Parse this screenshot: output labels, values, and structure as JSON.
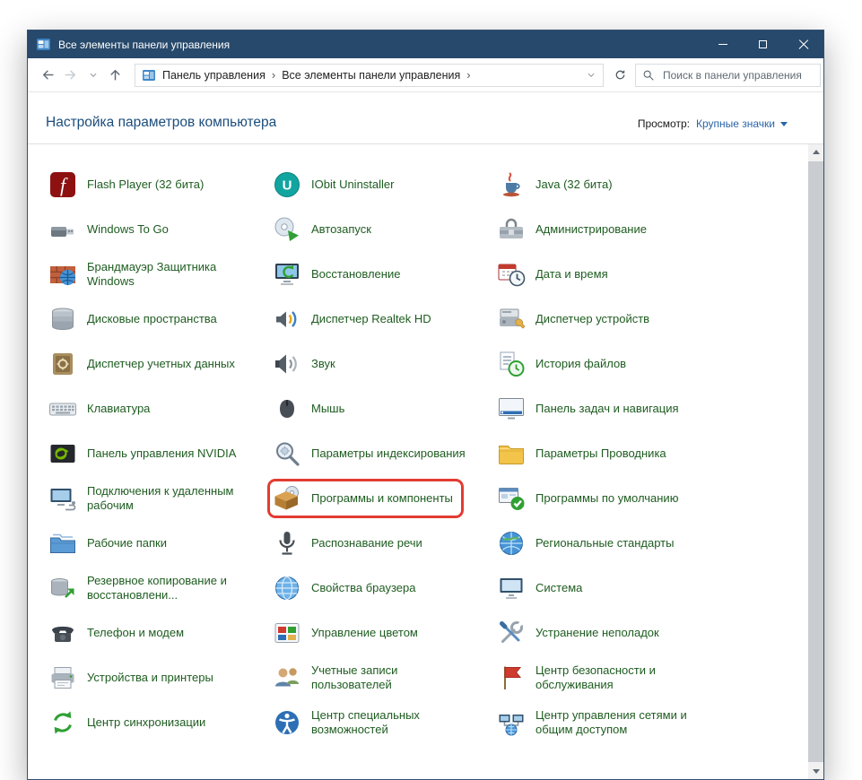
{
  "window": {
    "title": "Все элементы панели управления"
  },
  "toolbar": {
    "back_icon": "arrow-left",
    "forward_icon": "arrow-right",
    "recent_icon": "chevron-down",
    "up_icon": "arrow-up",
    "refresh_icon": "refresh",
    "breadcrumb": {
      "root_icon": "control-panel",
      "separator": "›",
      "items": [
        "Панель управления",
        "Все элементы панели управления"
      ]
    },
    "search": {
      "icon": "search",
      "placeholder": "Поиск в панели управления"
    }
  },
  "header": {
    "title": "Настройка параметров компьютера",
    "view_label": "Просмотр:",
    "view_value": "Крупные значки"
  },
  "annotation": {
    "shape": "rounded-rectangle",
    "color": "#e23c32",
    "target": "Программы и компоненты"
  },
  "items": [
    {
      "label": "Flash Player (32 бита)",
      "icon": "flash-player"
    },
    {
      "label": "IObit Uninstaller",
      "icon": "iobit-uninstaller"
    },
    {
      "label": "Java (32 бита)",
      "icon": "java"
    },
    {
      "label": "Windows To Go",
      "icon": "windows-to-go"
    },
    {
      "label": "Автозапуск",
      "icon": "autoplay"
    },
    {
      "label": "Администрирование",
      "icon": "admin-tools"
    },
    {
      "label": "Брандмауэр Защитника Windows",
      "icon": "firewall"
    },
    {
      "label": "Восстановление",
      "icon": "recovery"
    },
    {
      "label": "Дата и время",
      "icon": "date-time"
    },
    {
      "label": "Дисковые пространства",
      "icon": "storage-spaces"
    },
    {
      "label": "Диспетчер Realtek HD",
      "icon": "realtek-audio"
    },
    {
      "label": "Диспетчер устройств",
      "icon": "device-manager"
    },
    {
      "label": "Диспетчер учетных данных",
      "icon": "credential-manager"
    },
    {
      "label": "Звук",
      "icon": "sound"
    },
    {
      "label": "История файлов",
      "icon": "file-history"
    },
    {
      "label": "Клавиатура",
      "icon": "keyboard"
    },
    {
      "label": "Мышь",
      "icon": "mouse"
    },
    {
      "label": "Панель задач и навигация",
      "icon": "taskbar-navigation"
    },
    {
      "label": "Панель управления NVIDIA",
      "icon": "nvidia-control-panel"
    },
    {
      "label": "Параметры индексирования",
      "icon": "indexing-options"
    },
    {
      "label": "Параметры Проводника",
      "icon": "explorer-options"
    },
    {
      "label": "Подключения к удаленным рабочим",
      "icon": "remote-desktop"
    },
    {
      "label": "Программы и компоненты",
      "icon": "programs-features",
      "highlight": true
    },
    {
      "label": "Программы по умолчанию",
      "icon": "default-programs"
    },
    {
      "label": "Рабочие папки",
      "icon": "work-folders"
    },
    {
      "label": "Распознавание речи",
      "icon": "speech-recognition"
    },
    {
      "label": "Региональные стандарты",
      "icon": "region"
    },
    {
      "label": "Резервное копирование и восстановлени...",
      "icon": "backup-restore"
    },
    {
      "label": "Свойства браузера",
      "icon": "internet-options"
    },
    {
      "label": "Система",
      "icon": "system"
    },
    {
      "label": "Телефон и модем",
      "icon": "phone-modem"
    },
    {
      "label": "Управление цветом",
      "icon": "color-management"
    },
    {
      "label": "Устранение неполадок",
      "icon": "troubleshooting"
    },
    {
      "label": "Устройства и принтеры",
      "icon": "devices-printers"
    },
    {
      "label": "Учетные записи пользователей",
      "icon": "user-accounts"
    },
    {
      "label": "Центр безопасности и обслуживания",
      "icon": "security-maintenance"
    },
    {
      "label": "Центр синхронизации",
      "icon": "sync-center"
    },
    {
      "label": "Центр специальных возможностей",
      "icon": "ease-of-access"
    },
    {
      "label": "Центр управления сетями и общим доступом",
      "icon": "network-sharing"
    }
  ]
}
